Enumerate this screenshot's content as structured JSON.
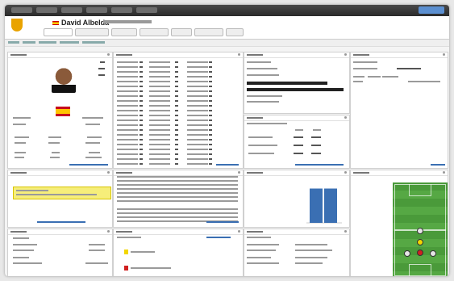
{
  "player": {
    "name": "David Albelda"
  },
  "colors": {
    "accent": "#3a6fb3",
    "warning_box": "#f6ee7a",
    "spain_red": "#c60b1e",
    "spain_yellow": "#ffc400",
    "pitch_green": "#4a9a3a"
  },
  "ratings_chart": {
    "values": [
      0.85,
      0.85
    ]
  },
  "icons": [
    "club-crest-icon",
    "flag-icon",
    "player-photo",
    "yellow-card-icon",
    "red-card-icon",
    "options-icon"
  ]
}
